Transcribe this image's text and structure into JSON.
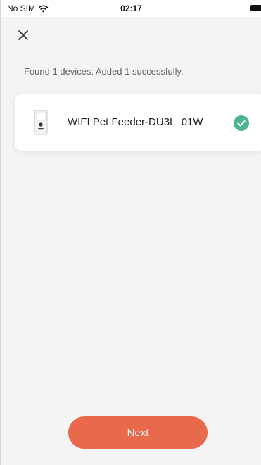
{
  "status_bar": {
    "carrier": "No SIM",
    "time": "02:17",
    "wifi_icon": "wifi-icon",
    "battery_icon": "battery-icon"
  },
  "header": {
    "close_icon": "close-icon"
  },
  "main": {
    "status_message": "Found 1 devices. Added 1 successfully.",
    "devices": [
      {
        "name": "WIFI Pet Feeder-DU3L_01W",
        "thumbnail_icon": "pet-feeder-device-icon",
        "status_icon": "check-circle-icon",
        "status_color": "#4cb58f"
      }
    ]
  },
  "footer": {
    "next_label": "Next",
    "next_color": "#e8694b"
  }
}
